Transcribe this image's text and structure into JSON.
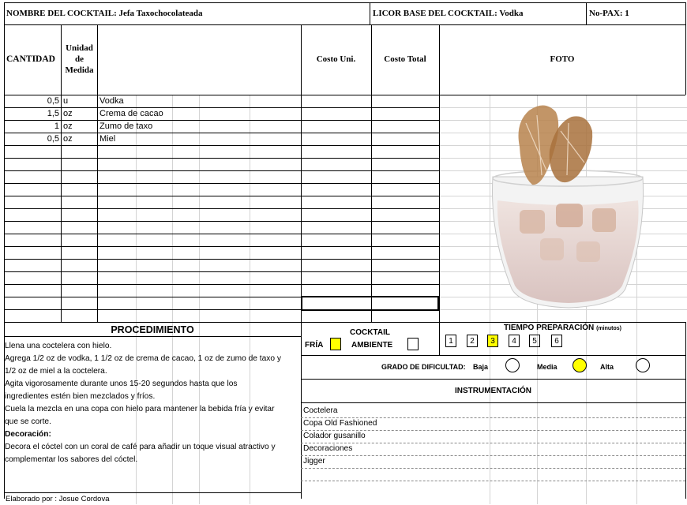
{
  "header": {
    "cocktail_name": "NOMBRE DEL COCKTAIL: Jefa Taxochocolateada",
    "base_liquor": "LICOR BASE DEL COCKTAIL: Vodka",
    "pax": "No-PAX: 1"
  },
  "columns": {
    "quantity": "CANTIDAD",
    "unit_line1": "Unidad",
    "unit_line2": "de",
    "unit_line3": "Medida",
    "unit_cost": "Costo Uni.",
    "total_cost": "Costo Total",
    "photo": "FOTO"
  },
  "ingredients": [
    {
      "qty": "0,5",
      "unit": "u",
      "name": "Vodka"
    },
    {
      "qty": "1,5",
      "unit": "oz",
      "name": "Crema de cacao"
    },
    {
      "qty": "1",
      "unit": "oz",
      "name": "Zumo de taxo"
    },
    {
      "qty": "0,5",
      "unit": "oz",
      "name": "Miel"
    }
  ],
  "procedure": {
    "title": "PROCEDIMIENTO",
    "lines": [
      "Llena una coctelera con hielo.",
      "Agrega 1/2 oz de vodka, 1 1/2 oz de crema de cacao, 1 oz de zumo de taxo y",
      "1/2 oz de miel a la coctelera.",
      " Agita vigorosamente durante unos 15-20 segundos hasta que los",
      "ingredientes estén bien mezclados y fríos.",
      "Cuela la mezcla en una copa con hielo para mantener la bebida fría y evitar",
      "que se corte."
    ],
    "decoration_title": "Decoración:",
    "decoration_lines": [
      "Decora el cóctel con un coral de café para añadir un toque visual atractivo y",
      "complementar los sabores del cóctel."
    ],
    "author": "Elaborado por : Josue Cordova"
  },
  "cocktail_type": {
    "title": "COCKTAIL",
    "cold_label": "FRÍA",
    "ambient_label": "AMBIENTE",
    "selected": "FRÍA"
  },
  "prep_time": {
    "title": "TIEMPO PREPARACIÓN",
    "unit": "(minutos)",
    "options": [
      "1",
      "2",
      "3",
      "4",
      "5",
      "6"
    ],
    "selected": "3"
  },
  "difficulty": {
    "title": "GRADO DE DIFICULTAD:",
    "low": "Baja",
    "medium": "Media",
    "high": "Alta",
    "selected": "Media"
  },
  "instruments": {
    "title": "INSTRUMENTACIÓN",
    "items": [
      "Coctelera",
      "Copa Old Fashioned",
      "Colador gusanillo",
      "Decoraciones",
      "Jigger"
    ]
  },
  "colors": {
    "highlight": "#ffff00",
    "gridline": "#d4d4d4"
  }
}
